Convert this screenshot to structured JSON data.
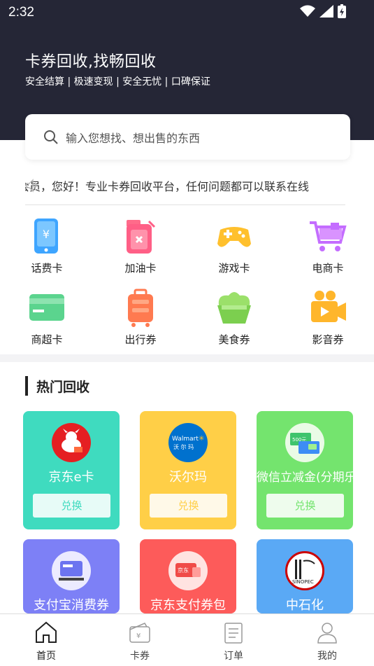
{
  "status": {
    "time": "2:32"
  },
  "header": {
    "title": "卡券回收,找畅回收",
    "subtitle": "安全结算 | 极速变现 | 安全无忧 | 口碑保证"
  },
  "search": {
    "placeholder": "输入您想找、想出售的东西"
  },
  "notice": {
    "text": "会员，您好！专业卡券回收平台，任何问题都可以联系在线"
  },
  "categories": [
    {
      "label": "话费卡",
      "icon": "phone-card-icon"
    },
    {
      "label": "加油卡",
      "icon": "fuel-can-icon"
    },
    {
      "label": "游戏卡",
      "icon": "gamepad-icon"
    },
    {
      "label": "电商卡",
      "icon": "shopping-cart-icon"
    },
    {
      "label": "商超卡",
      "icon": "bank-card-icon"
    },
    {
      "label": "出行券",
      "icon": "suitcase-icon"
    },
    {
      "label": "美食券",
      "icon": "food-icon"
    },
    {
      "label": "影音券",
      "icon": "video-camera-icon"
    }
  ],
  "hot": {
    "title": "热门回收",
    "cards": [
      {
        "name": "京东e卡",
        "button": "兑换",
        "color": "#3fdbbf",
        "logo_text": "JD"
      },
      {
        "name": "沃尔玛",
        "button": "兑换",
        "color": "#ffcf47",
        "logo_text": "Walmart✳\n沃 尔 玛"
      },
      {
        "name": "微信立减金(分期乐)",
        "button": "兑换",
        "color": "#74e46e",
        "logo_text": "500元"
      },
      {
        "name": "支付宝消费券",
        "color": "#7d80f6",
        "logo_text": "消费券"
      },
      {
        "name": "京东支付券包",
        "color": "#fd5b5a",
        "logo_text": "京东"
      },
      {
        "name": "中石化",
        "color": "#5aa9f5",
        "logo_text": "SINOPEC"
      }
    ]
  },
  "tabs": [
    {
      "label": "首页",
      "icon": "home-icon",
      "active": true
    },
    {
      "label": "卡券",
      "icon": "wallet-icon"
    },
    {
      "label": "订单",
      "icon": "order-icon"
    },
    {
      "label": "我的",
      "icon": "profile-icon"
    }
  ],
  "colors": {
    "header_bg": "#252636",
    "tab_active": "#222222",
    "tab_inactive": "#444444"
  }
}
